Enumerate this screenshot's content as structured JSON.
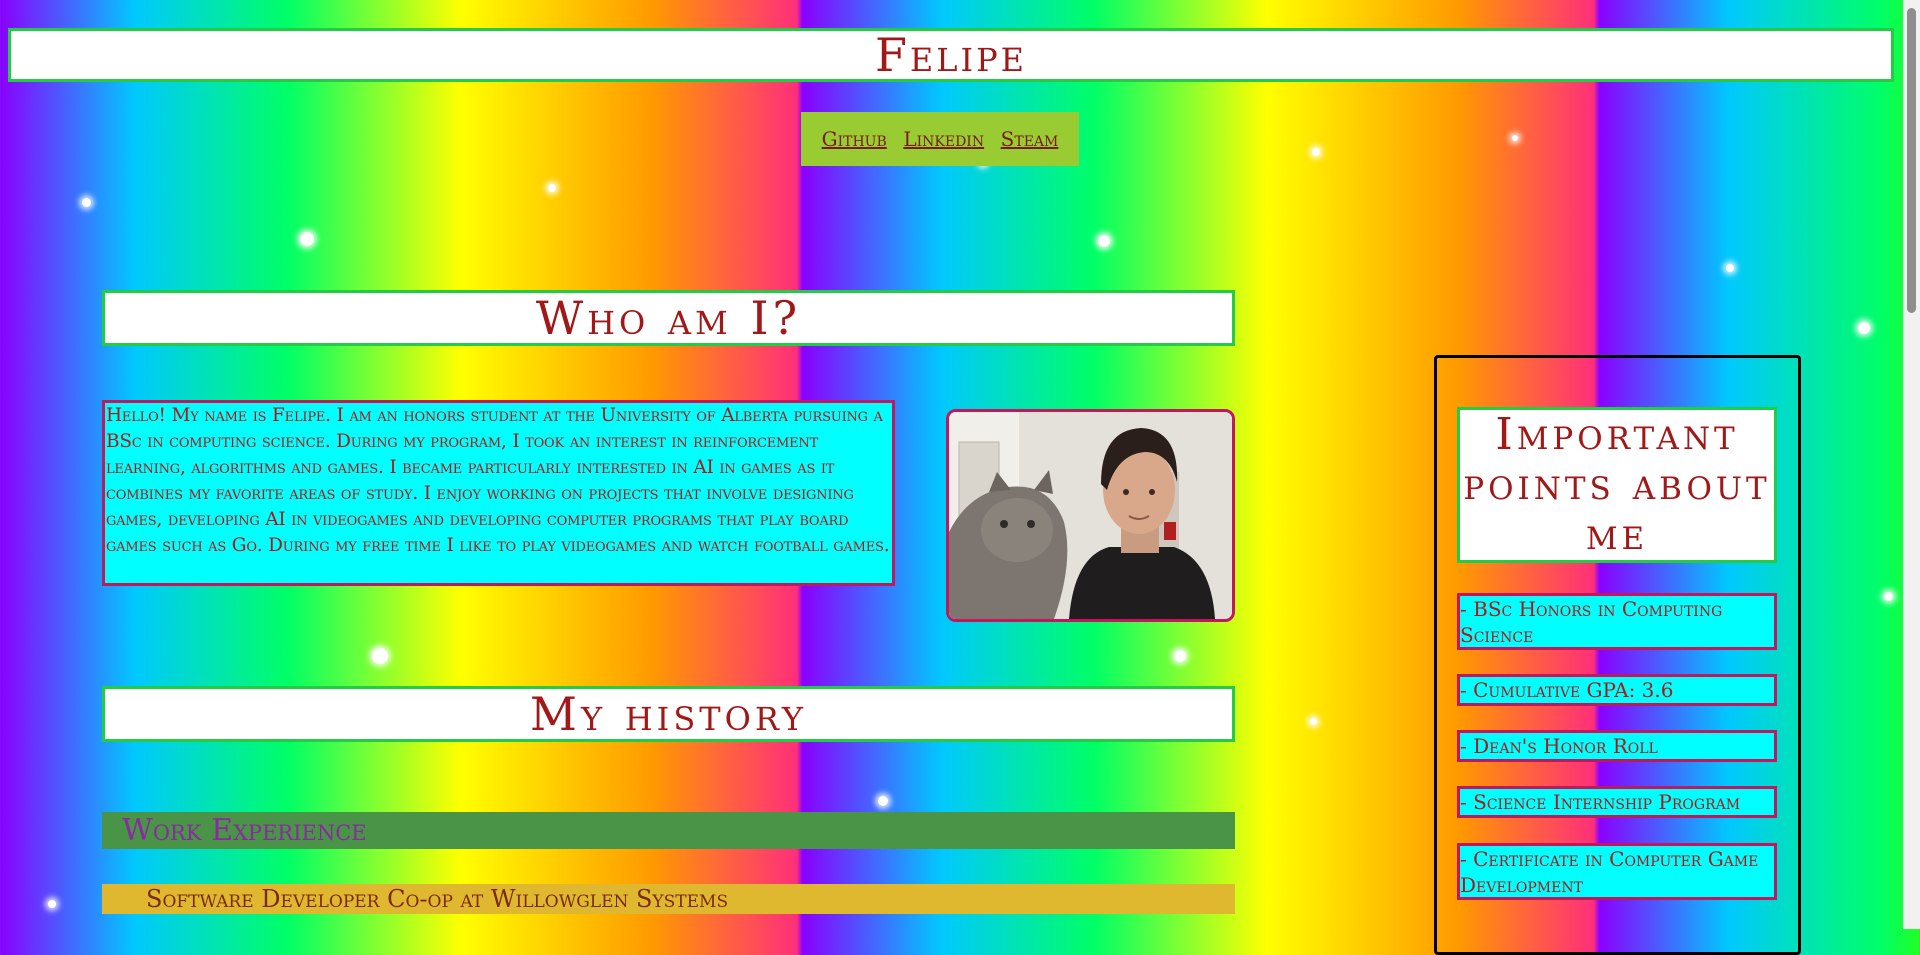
{
  "header": {
    "title": "Felipe"
  },
  "nav": {
    "links": [
      "Github",
      "Linkedin",
      "Steam"
    ]
  },
  "about": {
    "heading": "Who am I?",
    "bio": "Hello! My name is Felipe. I am an honors student at the University of Alberta pursuing a BSc in computing science. During my program, I took an interest in reinforcement learning, algorithms and games. I became particularly interested in AI in games as it combines my favorite areas of study. I enjoy working on projects that involve designing games, developing AI in videogames and developing computer programs that play board games such as Go. During my free time I like to play videogames and watch football games."
  },
  "history": {
    "heading": "My history",
    "work_heading": "Work Experience",
    "job_title": "Software Developer Co-op at Willowglen Systems"
  },
  "sidebar": {
    "title": "Important points about me",
    "points": [
      "- BSc Honors in Computing Science",
      "- Cumulative GPA: 3.6",
      "- Dean's Honor Roll",
      "- Science Internship Program",
      "- Certificate in Computer Game Development"
    ]
  },
  "colors": {
    "heading_text": "#a01818",
    "heading_border": "#22cc44",
    "box_background": "#00ffff",
    "box_border": "#c2185b",
    "nav_background": "#99cc33"
  }
}
